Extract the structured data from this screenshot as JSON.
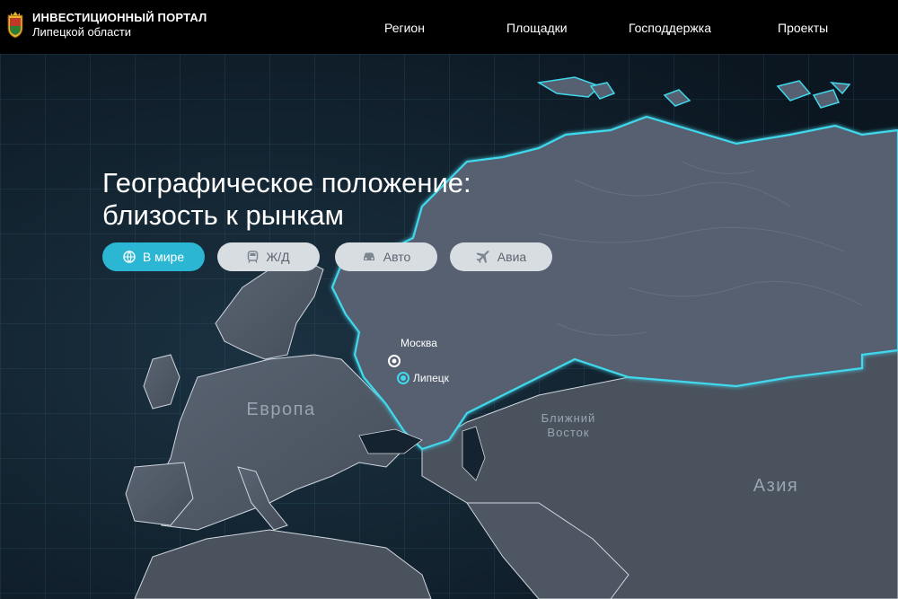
{
  "header": {
    "brand_title": "ИНВЕСТИЦИОННЫЙ ПОРТАЛ",
    "brand_subtitle": "Липецкой области",
    "nav": [
      {
        "label": "Регион"
      },
      {
        "label": "Площадки"
      },
      {
        "label": "Господдержка"
      },
      {
        "label": "Проекты"
      }
    ]
  },
  "hero": {
    "title_line1": "Географическое положение:",
    "title_line2": "близость к рынкам"
  },
  "modes": [
    {
      "label": "В мире",
      "icon": "globe-icon",
      "active": true
    },
    {
      "label": "Ж/Д",
      "icon": "train-icon",
      "active": false
    },
    {
      "label": "Авто",
      "icon": "car-icon",
      "active": false
    },
    {
      "label": "Авиа",
      "icon": "plane-icon",
      "active": false
    }
  ],
  "map": {
    "regions": {
      "europe": "Европа",
      "middle_east_line1": "Ближний",
      "middle_east_line2": "Восток",
      "asia": "Азия"
    },
    "cities": {
      "moscow": "Москва",
      "lipetsk": "Липецк"
    }
  },
  "colors": {
    "accent": "#2bb7d3",
    "header_bg": "#000000",
    "ocean": "#0d1a24",
    "land": "#4a5360",
    "russia": "#555e6c",
    "border_glow": "#3fd8ec"
  }
}
